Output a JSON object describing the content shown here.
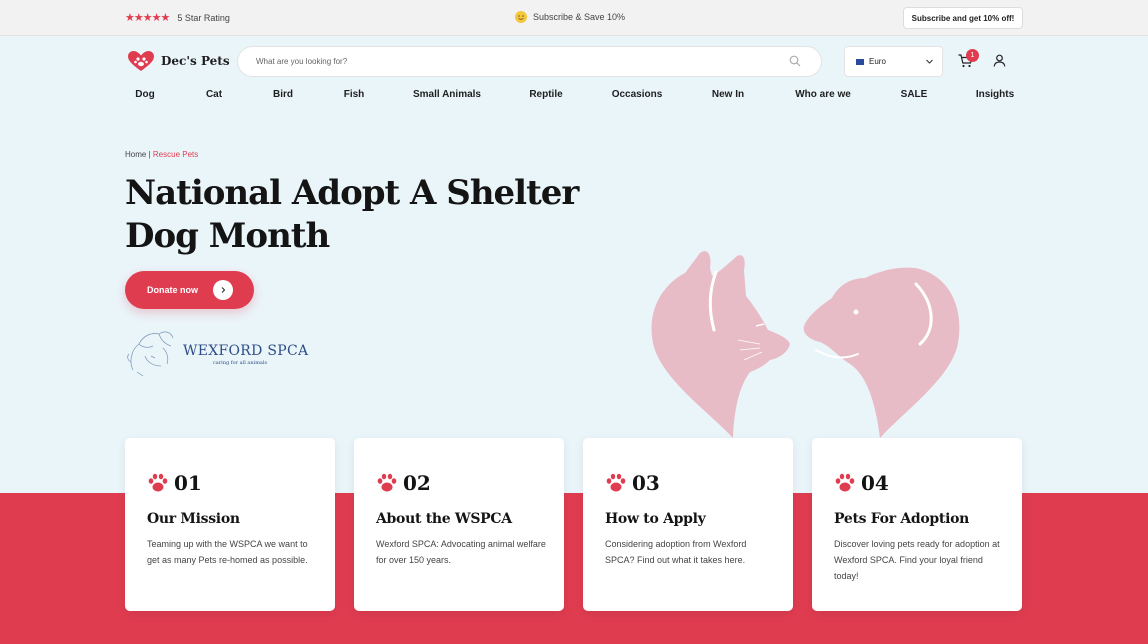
{
  "topbar": {
    "rating_label": "5 Star Rating",
    "stars": "★★★★★",
    "promo_text": "Subscribe & Save 10%",
    "subscribe_button": "Subscribe and get 10% off!"
  },
  "header": {
    "logo_text": "Dec's Pets",
    "search_placeholder": "What are you looking for?",
    "currency": "Euro",
    "cart_count": "1"
  },
  "nav": [
    {
      "label": "Dog"
    },
    {
      "label": "Cat"
    },
    {
      "label": "Bird"
    },
    {
      "label": "Fish"
    },
    {
      "label": "Small Animals"
    },
    {
      "label": "Reptile"
    },
    {
      "label": "Occasions"
    },
    {
      "label": "New In"
    },
    {
      "label": "Who are we"
    },
    {
      "label": "SALE"
    },
    {
      "label": "Insights"
    }
  ],
  "hero": {
    "breadcrumb_home": "Home",
    "breadcrumb_sep": "|",
    "breadcrumb_current": "Rescue Pets",
    "title": "National Adopt A Shelter Dog Month",
    "donate_label": "Donate now",
    "partner_name": "WEXFORD SPCA",
    "partner_tagline": "caring for all animals"
  },
  "cards": [
    {
      "number": "01",
      "title": "Our Mission",
      "text": "Teaming up with the WSPCA we want to get as many Pets re-homed as possible."
    },
    {
      "number": "02",
      "title": "About the WSPCA",
      "text": "Wexford SPCA: Advocating animal welfare for over 150 years."
    },
    {
      "number": "03",
      "title": "How to Apply",
      "text": "Considering adoption from Wexford SPCA? Find out what it takes here."
    },
    {
      "number": "04",
      "title": "Pets For Adoption",
      "text": "Discover loving pets ready for adoption at Wexford SPCA. Find your loyal friend today!"
    }
  ],
  "colors": {
    "accent": "#e03c50",
    "hero_bg": "#eaf5fa",
    "illustration": "#e8bcc6",
    "partner_blue": "#2d4d86"
  }
}
